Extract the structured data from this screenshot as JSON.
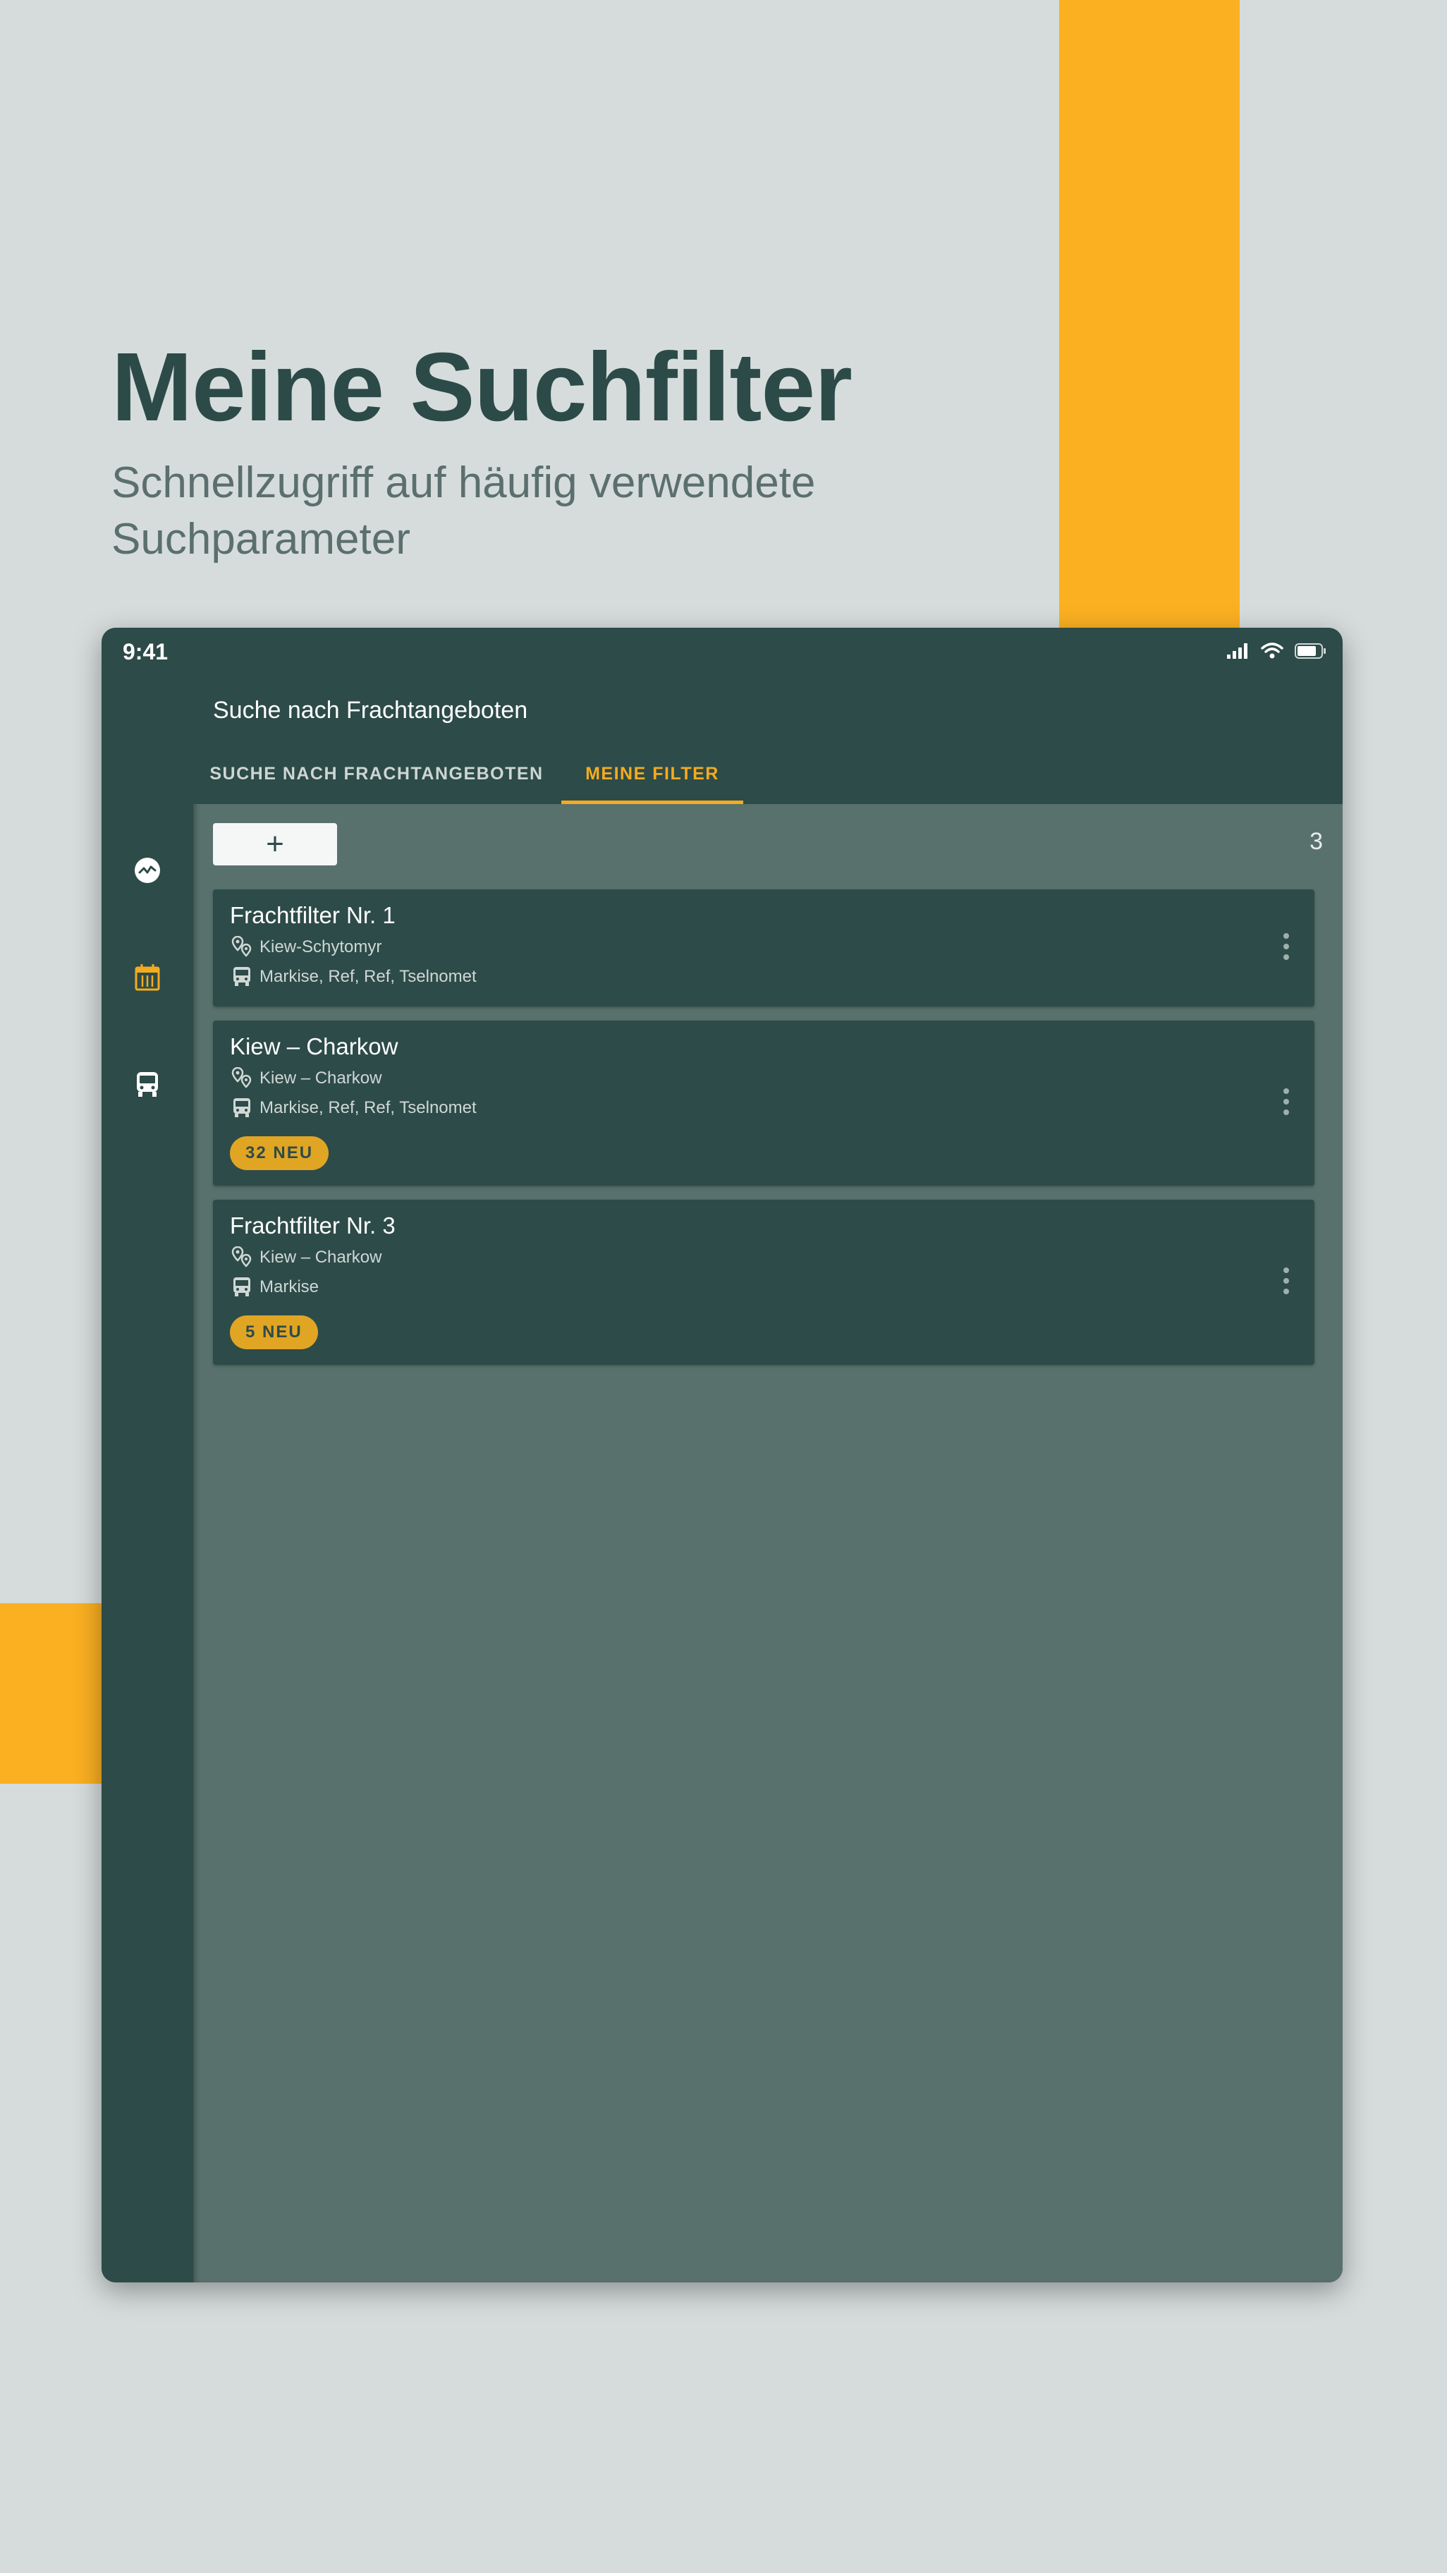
{
  "colors": {
    "accent": "#fbb022",
    "tab_active": "#f5ab1f",
    "badge": "#e1a524",
    "dark_green": "#2d4b48",
    "content_bg": "#58716c",
    "page_bg": "#d6dcdc"
  },
  "promo": {
    "title": "Meine Suchfilter",
    "subtitle": "Schnellzugriff auf häufig verwendete Suchparameter"
  },
  "status_bar": {
    "time": "9:41",
    "icons": [
      "signal-icon",
      "wifi-icon",
      "battery-icon"
    ]
  },
  "nav_rail": {
    "items": [
      {
        "icon": "activity-icon",
        "active": false
      },
      {
        "icon": "calendar-icon",
        "active": true
      },
      {
        "icon": "truck-icon",
        "active": false
      }
    ]
  },
  "app_bar": {
    "title": "Suche nach Frachtangeboten",
    "tabs": [
      {
        "label": "SUCHE NACH FRACHTANGEBOTEN",
        "active": false
      },
      {
        "label": "MEINE FILTER",
        "active": true
      }
    ]
  },
  "toolbar": {
    "add_label": "+",
    "count": "3"
  },
  "filters": [
    {
      "title": "Frachtfilter Nr. 1",
      "route": "Kiew-Schytomyr",
      "vehicles": "Markise, Ref, Ref, Tselnomet"
    },
    {
      "title": "Kiew – Charkow",
      "route": "Kiew – Charkow",
      "vehicles": "Markise, Ref, Ref, Tselnomet",
      "badge": "32 NEU"
    },
    {
      "title": "Frachtfilter Nr. 3",
      "route": "Kiew – Charkow",
      "vehicles": "Markise",
      "badge": "5 NEU"
    }
  ]
}
